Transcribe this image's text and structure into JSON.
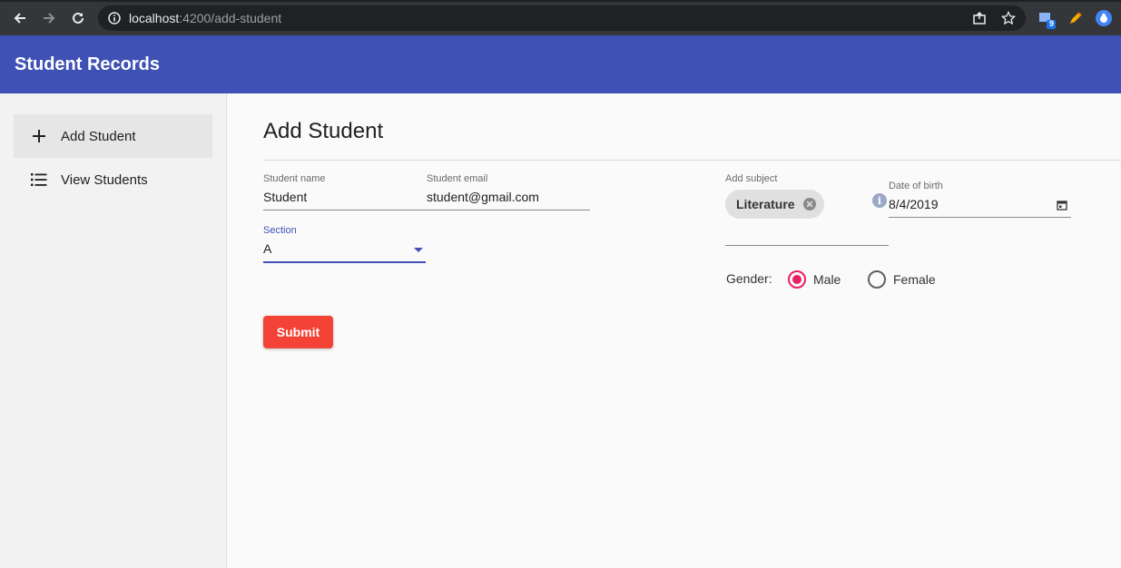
{
  "browser": {
    "url_host": "localhost",
    "url_rest": ":4200/add-student",
    "extension_badge": "9"
  },
  "app": {
    "title": "Student Records",
    "colors": {
      "primary": "#3f51b5",
      "accent": "#e91e63",
      "warn": "#f44336"
    }
  },
  "sidebar": {
    "items": [
      {
        "label": "Add Student",
        "icon": "plus-icon",
        "active": true
      },
      {
        "label": "View Students",
        "icon": "list-icon",
        "active": false
      }
    ]
  },
  "form": {
    "title": "Add Student",
    "student_name": {
      "label": "Student name",
      "value": "Student"
    },
    "student_email": {
      "label": "Student email",
      "value": "student@gmail.com"
    },
    "section": {
      "label": "Section",
      "value": "A"
    },
    "subject": {
      "label": "Add subject",
      "chips": [
        "Literature"
      ]
    },
    "dob": {
      "label": "Date of birth",
      "value": "8/4/2019",
      "info_icon": "i"
    },
    "gender": {
      "label": "Gender:",
      "options": [
        {
          "label": "Male",
          "checked": true
        },
        {
          "label": "Female",
          "checked": false
        }
      ]
    },
    "submit_label": "Submit"
  }
}
